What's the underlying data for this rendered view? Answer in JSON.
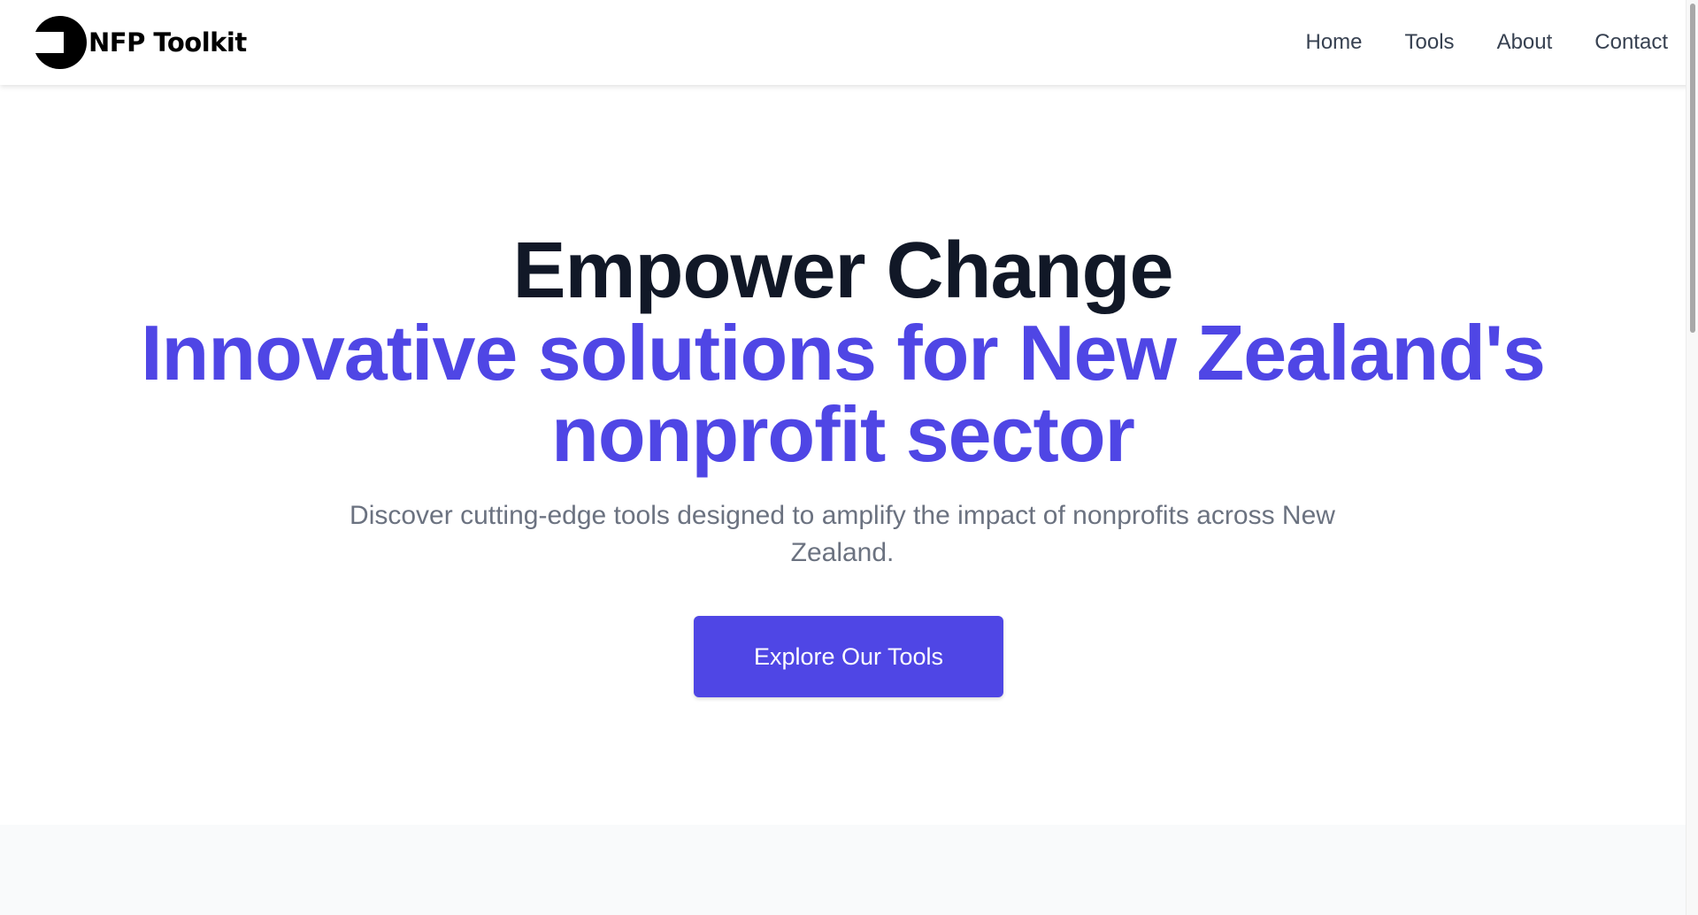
{
  "brand": {
    "name": "NFP Toolkit",
    "logo_icon": "wrench-key-icon",
    "logo_color": "#000000"
  },
  "nav": {
    "items": [
      {
        "label": "Home"
      },
      {
        "label": "Tools"
      },
      {
        "label": "About"
      },
      {
        "label": "Contact"
      }
    ]
  },
  "hero": {
    "title": "Empower Change",
    "subtitle": "Innovative solutions for New Zealand's nonprofit sector",
    "description": "Discover cutting-edge tools designed to amplify the impact of nonprofits across New Zealand.",
    "cta_label": "Explore Our Tools"
  },
  "colors": {
    "accent": "#4f46e5",
    "heading": "#111827",
    "body_text": "#6b7280",
    "nav_text": "#374151",
    "section_bg": "#f9fafb"
  }
}
